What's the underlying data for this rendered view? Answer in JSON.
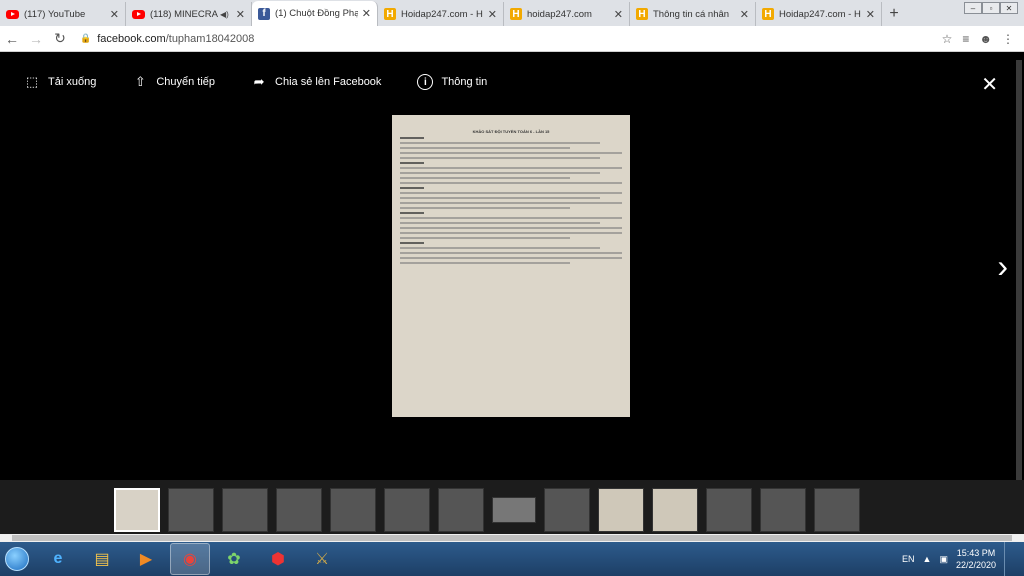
{
  "tabs": [
    {
      "label": "(117) YouTube",
      "favicon": "youtube-icon",
      "active": false,
      "audio": false
    },
    {
      "label": "(118) MINECRA",
      "favicon": "youtube-icon",
      "active": false,
      "audio": true
    },
    {
      "label": "(1) Chuột Đồng Phạ",
      "favicon": "facebook-icon",
      "active": true,
      "audio": false
    },
    {
      "label": "Hoidap247.com - H",
      "favicon": "hoidap247-icon",
      "active": false,
      "audio": false
    },
    {
      "label": "hoidap247.com",
      "favicon": "hoidap247-icon",
      "active": false,
      "audio": false
    },
    {
      "label": "Thông tin cá nhân",
      "favicon": "hoidap247-icon",
      "active": false,
      "audio": false
    },
    {
      "label": "Hoidap247.com - H",
      "favicon": "hoidap247-icon",
      "active": false,
      "audio": false
    }
  ],
  "address": {
    "host": "facebook.com",
    "path": "/tupham18042008"
  },
  "viewer": {
    "actions": [
      {
        "label": "Tải xuống",
        "icon": "download-tag-icon"
      },
      {
        "label": "Chuyển tiếp",
        "icon": "share-icon"
      },
      {
        "label": "Chia sẻ lên Facebook",
        "icon": "forward-arrow-icon"
      },
      {
        "label": "Thông tin",
        "icon": "info-icon"
      }
    ],
    "photo_heading": "KHẢO SÁT ĐỘI TUYỂN TOÁN 6 - LẦN 15"
  },
  "taskbar": {
    "language": "EN",
    "time": "15:43 PM",
    "date": "22/2/2020"
  }
}
